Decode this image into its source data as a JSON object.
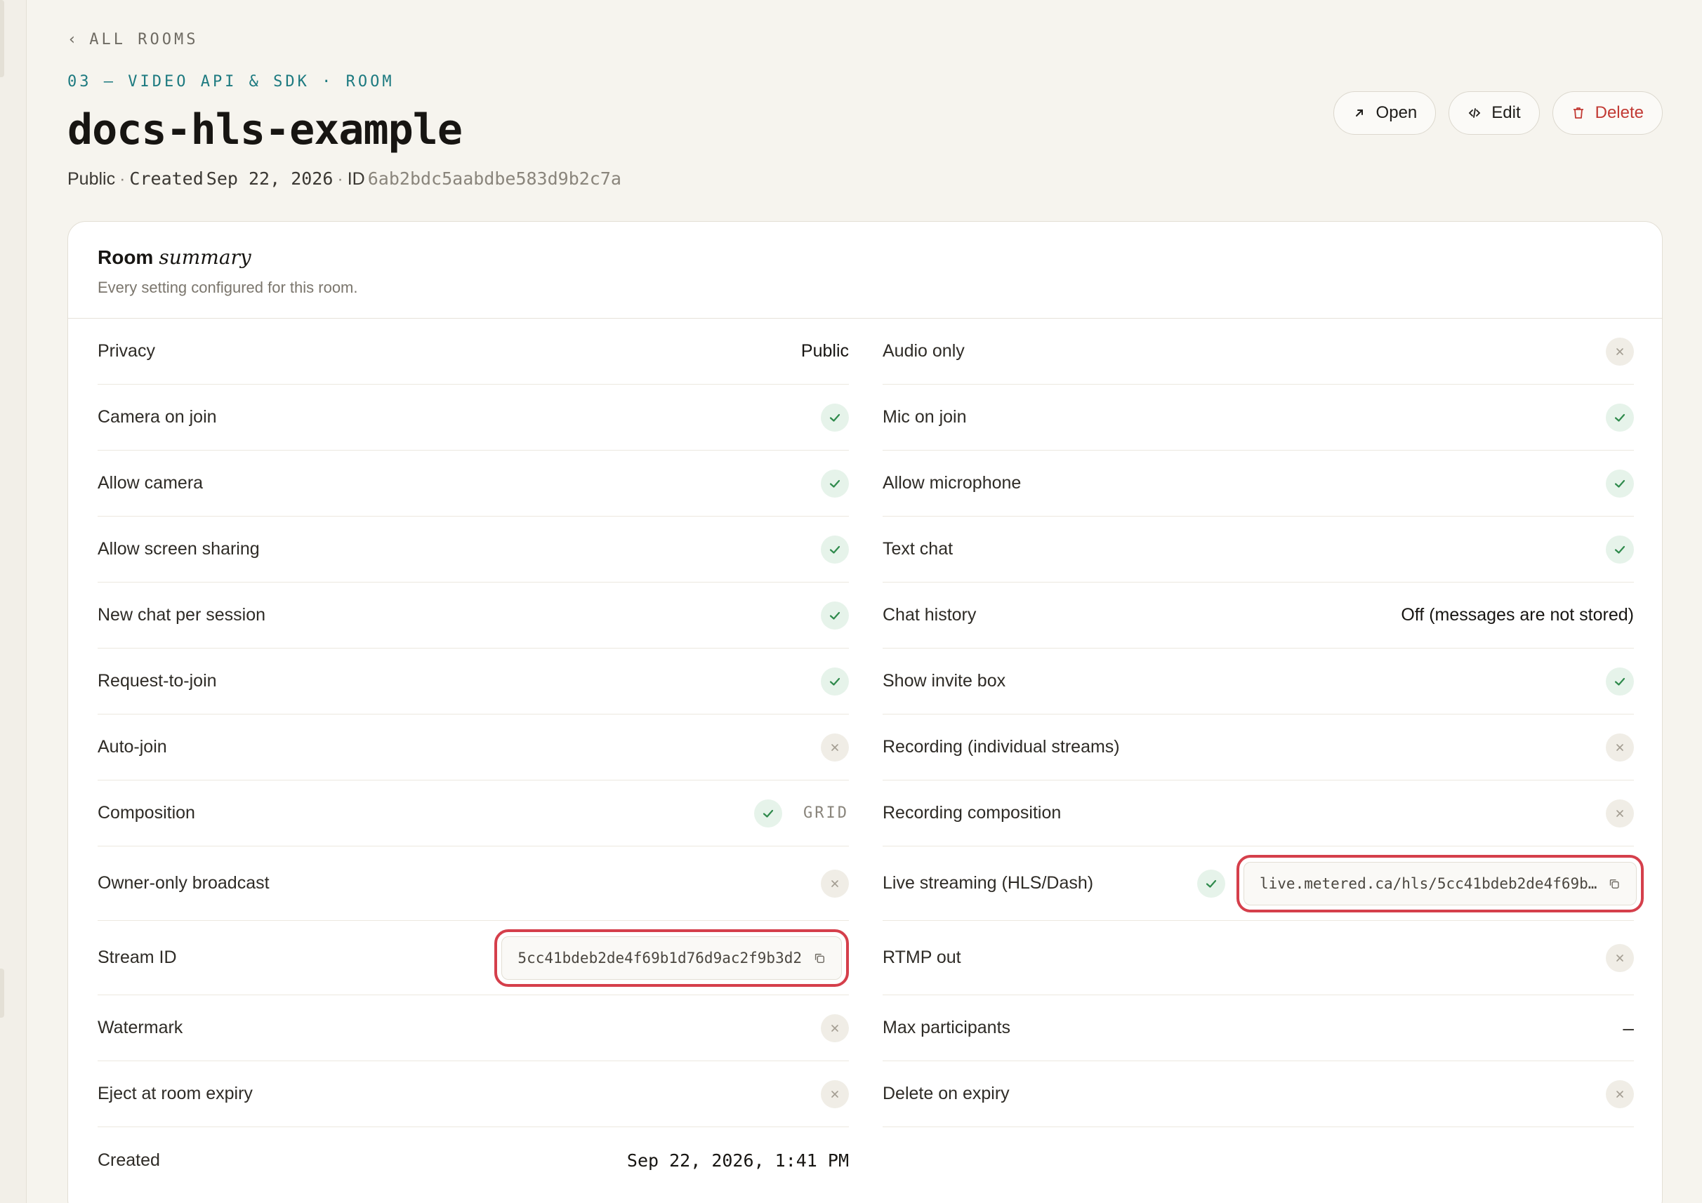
{
  "nav": {
    "back_label": "ALL ROOMS"
  },
  "header": {
    "eyebrow": "03 — VIDEO API & SDK · ROOM",
    "title": "docs-hls-example",
    "privacy": "Public",
    "created_label": "Created",
    "created_date": "Sep 22, 2026",
    "id_label": "ID",
    "id_value": "6ab2bdc5aabdbe583d9b2c7a"
  },
  "actions": {
    "open_label": "Open",
    "edit_label": "Edit",
    "delete_label": "Delete"
  },
  "card": {
    "title_strong": "Room",
    "title_em": "summary",
    "subtitle": "Every setting configured for this room."
  },
  "left_rows": {
    "privacy": {
      "label": "Privacy",
      "value": "Public"
    },
    "camera_on_join": {
      "label": "Camera on join",
      "state": "on"
    },
    "allow_camera": {
      "label": "Allow camera",
      "state": "on"
    },
    "allow_screen_sharing": {
      "label": "Allow screen sharing",
      "state": "on"
    },
    "new_chat_per_session": {
      "label": "New chat per session",
      "state": "on"
    },
    "request_to_join": {
      "label": "Request-to-join",
      "state": "on"
    },
    "auto_join": {
      "label": "Auto-join",
      "state": "off"
    },
    "composition": {
      "label": "Composition",
      "state": "on",
      "tag": "GRID"
    },
    "owner_only_broadcast": {
      "label": "Owner-only broadcast",
      "state": "off"
    },
    "stream_id": {
      "label": "Stream ID",
      "value": "5cc41bdeb2de4f69b1d76d9ac2f9b3d2"
    },
    "watermark": {
      "label": "Watermark",
      "state": "off"
    },
    "eject_at_room_expiry": {
      "label": "Eject at room expiry",
      "state": "off"
    },
    "created": {
      "label": "Created",
      "value": "Sep 22, 2026, 1:41 PM"
    }
  },
  "right_rows": {
    "audio_only": {
      "label": "Audio only",
      "state": "off"
    },
    "mic_on_join": {
      "label": "Mic on join",
      "state": "on"
    },
    "allow_microphone": {
      "label": "Allow microphone",
      "state": "on"
    },
    "text_chat": {
      "label": "Text chat",
      "state": "on"
    },
    "chat_history": {
      "label": "Chat history",
      "value": "Off (messages are not stored)"
    },
    "show_invite_box": {
      "label": "Show invite box",
      "state": "on"
    },
    "recording_individual": {
      "label": "Recording (individual streams)",
      "state": "off"
    },
    "recording_composition": {
      "label": "Recording composition",
      "state": "off"
    },
    "live_streaming": {
      "label": "Live streaming (HLS/Dash)",
      "state": "on",
      "value": "live.metered.ca/hls/5cc41bdeb2de4f69b…"
    },
    "rtmp_out": {
      "label": "RTMP out",
      "state": "off"
    },
    "max_participants": {
      "label": "Max participants",
      "value": "–"
    },
    "delete_on_expiry": {
      "label": "Delete on expiry",
      "state": "off"
    }
  },
  "colors": {
    "accent_teal": "#1d7a80",
    "danger": "#c23a34",
    "highlight": "#d53f4b",
    "check_green": "#2f8a4c"
  },
  "icons": [
    "chevron-left-icon",
    "arrow-up-right-icon",
    "code-icon",
    "trash-icon",
    "check-icon",
    "x-icon",
    "copy-icon"
  ]
}
